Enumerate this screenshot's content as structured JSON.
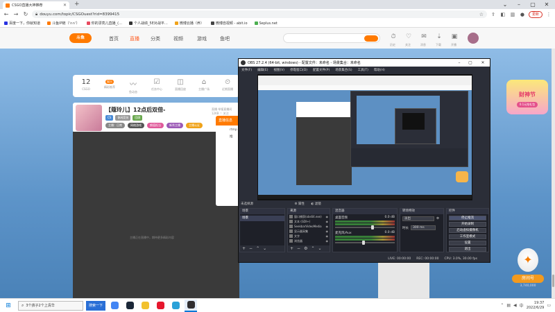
{
  "chrome": {
    "tab_title": "CSGO直播大神推荐",
    "new_tab": "+",
    "url": "douyu.com/topic/CSGOuest?rid=8399415",
    "update_label": "更新",
    "bookmarks": [
      {
        "label": "百度一下，你就知道",
        "color": "#2932e1"
      },
      {
        "label": "斗鱼IP链（'∩∩'）",
        "color": "#ff7a00"
      },
      {
        "label": "你的漂亮儿直播_(…",
        "color": "#e84a5f"
      },
      {
        "label": "个人战绩_5E对战平…",
        "color": "#333333"
      },
      {
        "label": "微博云播（养）",
        "color": "#f0a31a"
      },
      {
        "label": "微博自视频 - abit.io",
        "color": "#444444"
      },
      {
        "label": "Seplus.net",
        "color": "#4caf50"
      }
    ]
  },
  "douyu": {
    "logo_text": "斗鱼",
    "nav": [
      "首页",
      "直播",
      "分类",
      "视频",
      "游戏",
      "鱼吧"
    ],
    "nav_active_index": 1,
    "icons": [
      {
        "name": "history-icon",
        "glyph": "⏱",
        "label": "历史"
      },
      {
        "name": "follow-icon",
        "glyph": "♡",
        "label": "关注"
      },
      {
        "name": "message-icon",
        "glyph": "✉",
        "label": "消息"
      },
      {
        "name": "download-icon",
        "glyph": "⇣",
        "label": "下载"
      },
      {
        "name": "live-open-icon",
        "glyph": "▣",
        "label": "开播"
      }
    ],
    "side_items": [
      {
        "kind": "num",
        "value": "12",
        "label": "CSGO"
      },
      {
        "kind": "badge",
        "value": "娱乐",
        "label": "精彩推荐"
      },
      {
        "kind": "icon",
        "value": "〰",
        "label": "鱼动态"
      },
      {
        "kind": "icon",
        "value": "☑",
        "label": "任务中心"
      },
      {
        "kind": "icon",
        "value": "◫",
        "label": "直播回放"
      },
      {
        "kind": "icon",
        "value": "⌂",
        "label": "主播广场"
      },
      {
        "kind": "icon",
        "value": "⏲",
        "label": "近期直播"
      }
    ],
    "anchor": {
      "title": "【蔻玲儿】12点后双倍-",
      "meta": "直播   举报直播间   12KB ♡ 关注",
      "level": "主播：日常",
      "tags": [
        {
          "label": "CS",
          "color": "#4a8bd6"
        },
        {
          "label": "休闲竞技",
          "color": "#999999"
        },
        {
          "label": "回顾",
          "color": "#6aa84f"
        }
      ],
      "pills": [
        {
          "label": "网络游戏",
          "color": "#555555"
        },
        {
          "label": "颜值担当",
          "color": "#e05a9a"
        },
        {
          "label": "新秀主播",
          "color": "#9b59b6"
        },
        {
          "label": "主播认证",
          "color": "#f0a31a"
        }
      ]
    },
    "popup": {
      "title": "直播信息",
      "lines": [
        "rtmp",
        "推"
      ]
    },
    "broadcast_note": "主播正在直播中，期待更多精彩内容",
    "promo_top": {
      "title": "财神节",
      "sub": "0.1元抢礼包"
    },
    "promo_bottom": {
      "button": "房间号",
      "count": "3,740,000"
    }
  },
  "obs": {
    "title": "OBS 27.2.4 (64-bit, windows) - 配置文件：未命名 - 场景集合：未命名",
    "menu": [
      "文件(F)",
      "编辑(E)",
      "视图(V)",
      "停靠窗口(D)",
      "配置文件(P)",
      "场景集合(S)",
      "工具(T)",
      "帮助(H)"
    ],
    "dock_bar": {
      "label": "未选择源",
      "props": "属性",
      "filters": "滤镜"
    },
    "scenes": {
      "title": "场景",
      "items": [
        "场景"
      ]
    },
    "sources": {
      "title": "来源",
      "items": [
        "窗口捕获(obs64.exe)",
        "文本 (GDI+)",
        "SeekbarVideoMedia",
        "显示器采集",
        "文字",
        "浏览器"
      ]
    },
    "mixer": {
      "title": "混音器",
      "channels": [
        {
          "name": "桌面音频",
          "db": "0.0 dB",
          "level": 0.6
        },
        {
          "name": "麦克风/Aux",
          "db": "0.0 dB",
          "level": 0.45
        }
      ]
    },
    "transitions": {
      "title": "转场特效",
      "type": "淡出",
      "duration_label": "时长",
      "duration": "300 ms"
    },
    "controls": {
      "title": "控件",
      "buttons": [
        "停止推流",
        "开始录制",
        "启动虚拟摄像机",
        "工作室模式",
        "设置",
        "退出"
      ],
      "active_index": 0
    },
    "status": {
      "live": "LIVE: 00:00:00",
      "rec": "REC: 00:00:00",
      "cpu": "CPU: 3.0%, 30.00 fps"
    }
  },
  "taskbar": {
    "search_text": "3个孩子2个上清华",
    "chip": "搜索一下",
    "apps": [
      {
        "name": "chrome-taskbar-icon",
        "color": "#4285f4",
        "active": false
      },
      {
        "name": "steam-taskbar-icon",
        "color": "#1b2838",
        "active": false
      },
      {
        "name": "game-taskbar-icon",
        "color": "#f2c12e",
        "active": false
      },
      {
        "name": "weibo-taskbar-icon",
        "color": "#e6162d",
        "active": false
      },
      {
        "name": "app-taskbar-icon",
        "color": "#2aa1d8",
        "active": false
      },
      {
        "name": "obs-taskbar-icon",
        "color": "#302e31",
        "active": true
      }
    ],
    "time": "19:37",
    "date": "2022/6/29"
  }
}
